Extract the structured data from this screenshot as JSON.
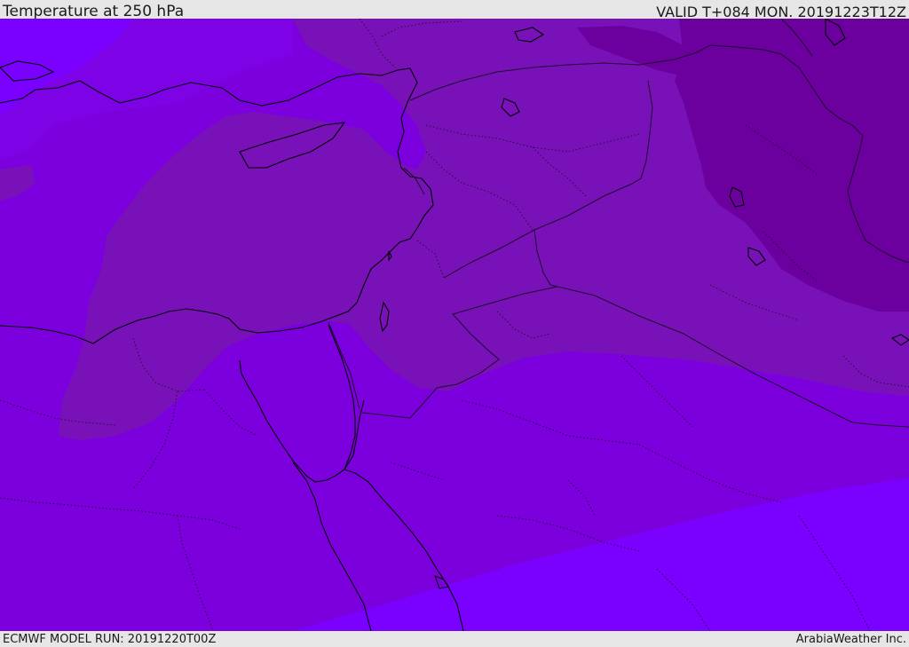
{
  "header": {
    "title": "Temperature at 250 hPa",
    "valid": "VALID T+084 MON. 20191223T12Z"
  },
  "footer": {
    "model_run": "ECMWF MODEL RUN: 20191220T00Z",
    "credit": "ArabiaWeather Inc."
  },
  "colors": {
    "zone_lightest": "#7a00ff",
    "zone_light": "#7d02e6",
    "zone_base": "#7c00de",
    "zone_mid": "#7812b8",
    "zone_dark": "#6b009e",
    "coast": "#000000",
    "border": "#1e0a2a"
  }
}
